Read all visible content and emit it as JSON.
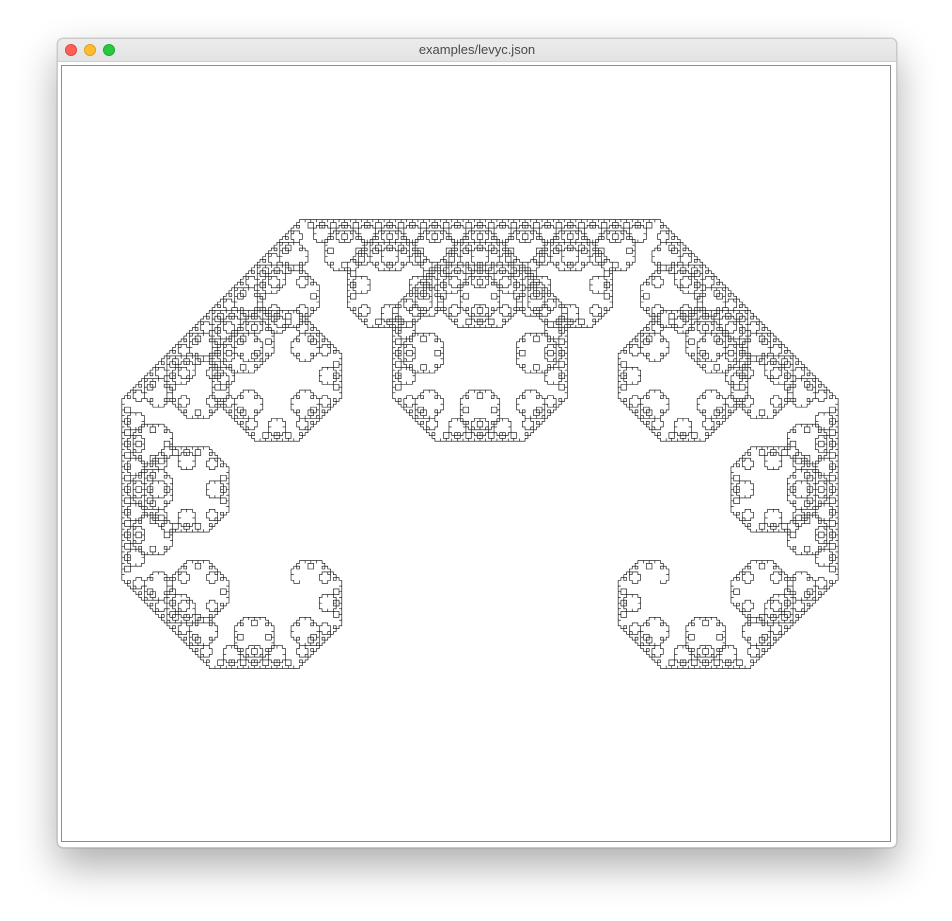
{
  "window": {
    "title": "examples/levyc.json",
    "controls": {
      "close": "close-icon",
      "minimize": "minimize-icon",
      "zoom": "zoom-icon"
    }
  },
  "canvas": {
    "stroke_color": "#000000",
    "background_color": "#ffffff"
  }
}
